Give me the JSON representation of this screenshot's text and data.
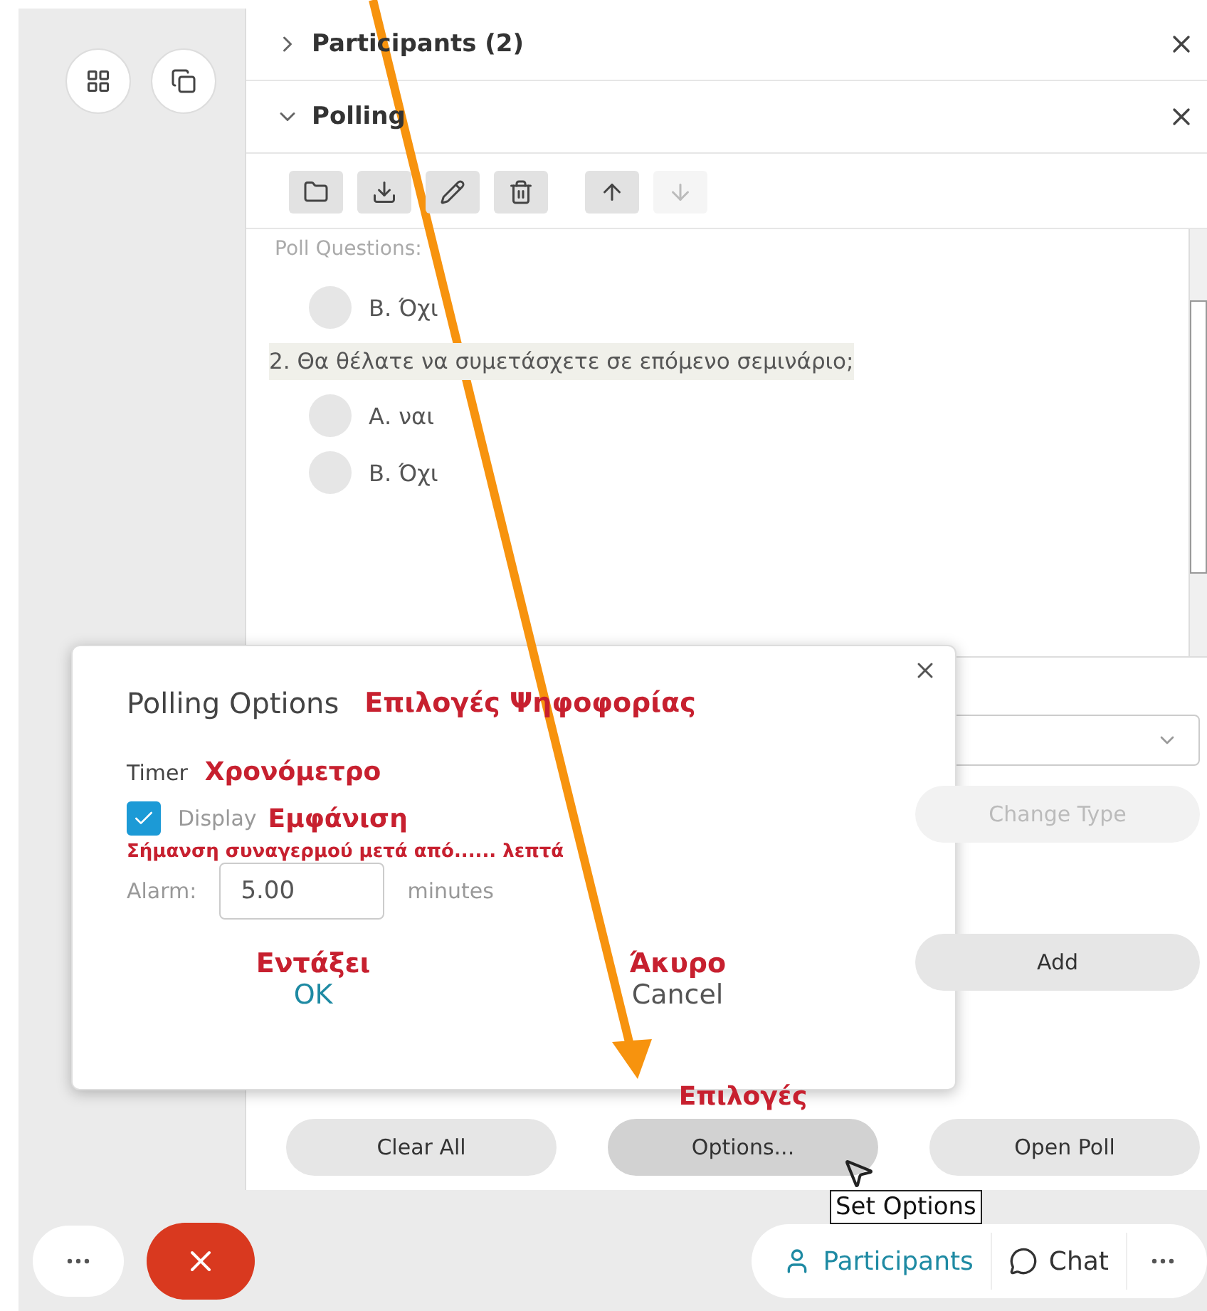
{
  "panels": [
    {
      "title": "Participants (2)",
      "expanded": false
    },
    {
      "title": "Polling",
      "expanded": true
    }
  ],
  "toolbar": [
    {
      "kind": "folder",
      "disabled": false
    },
    {
      "kind": "download",
      "disabled": false
    },
    {
      "kind": "pencil",
      "disabled": false
    },
    {
      "kind": "trash",
      "disabled": false
    },
    {
      "kind": "up",
      "disabled": false
    },
    {
      "kind": "down",
      "disabled": true
    }
  ],
  "poll": {
    "label": "Poll Questions:",
    "items": [
      {
        "kind": "option",
        "text": "Β. Όχι",
        "selected": false
      },
      {
        "kind": "question",
        "text": "2.  Θα θέλατε να συμετάσχετε σε επόμενο σεμινάριο;"
      },
      {
        "kind": "option",
        "text": "Α.  ναι",
        "selected": false
      },
      {
        "kind": "option",
        "text": "Β.  Όχι",
        "selected": false
      }
    ]
  },
  "side_buttons": [
    {
      "label": "Change Type",
      "disabled": true
    },
    {
      "label": "Add",
      "disabled": false
    }
  ],
  "bottom_buttons": [
    {
      "label": "Clear All",
      "hovered": false
    },
    {
      "label": "Options...",
      "hovered": true,
      "annotation": "Επιλογές"
    },
    {
      "label": "Open Poll",
      "hovered": false
    }
  ],
  "tooltip": "Set Options",
  "dialog": {
    "title": "Polling Options",
    "title_annotation": "Επιλογές Ψηφοφορίας",
    "timer_label": "Timer",
    "timer_annotation": "Χρονόμετρο",
    "display_label": "Display",
    "display_annotation": "Εμφάνιση",
    "display_checked": true,
    "alarm_annotation": "Σήμανση συναγερμού μετά από...... λεπτά",
    "alarm_label": "Alarm:",
    "alarm_value": "5.00",
    "alarm_unit": "minutes",
    "buttons": [
      {
        "label": "OK",
        "annotation": "Εντάξει",
        "kind": "primary"
      },
      {
        "label": "Cancel",
        "annotation": "Άκυρο",
        "kind": "secondary"
      }
    ]
  },
  "call_bar": {
    "tabs": [
      {
        "label": "Participants",
        "selected": true,
        "kind": "participants"
      },
      {
        "label": "Chat",
        "selected": false,
        "kind": "chat"
      }
    ]
  }
}
